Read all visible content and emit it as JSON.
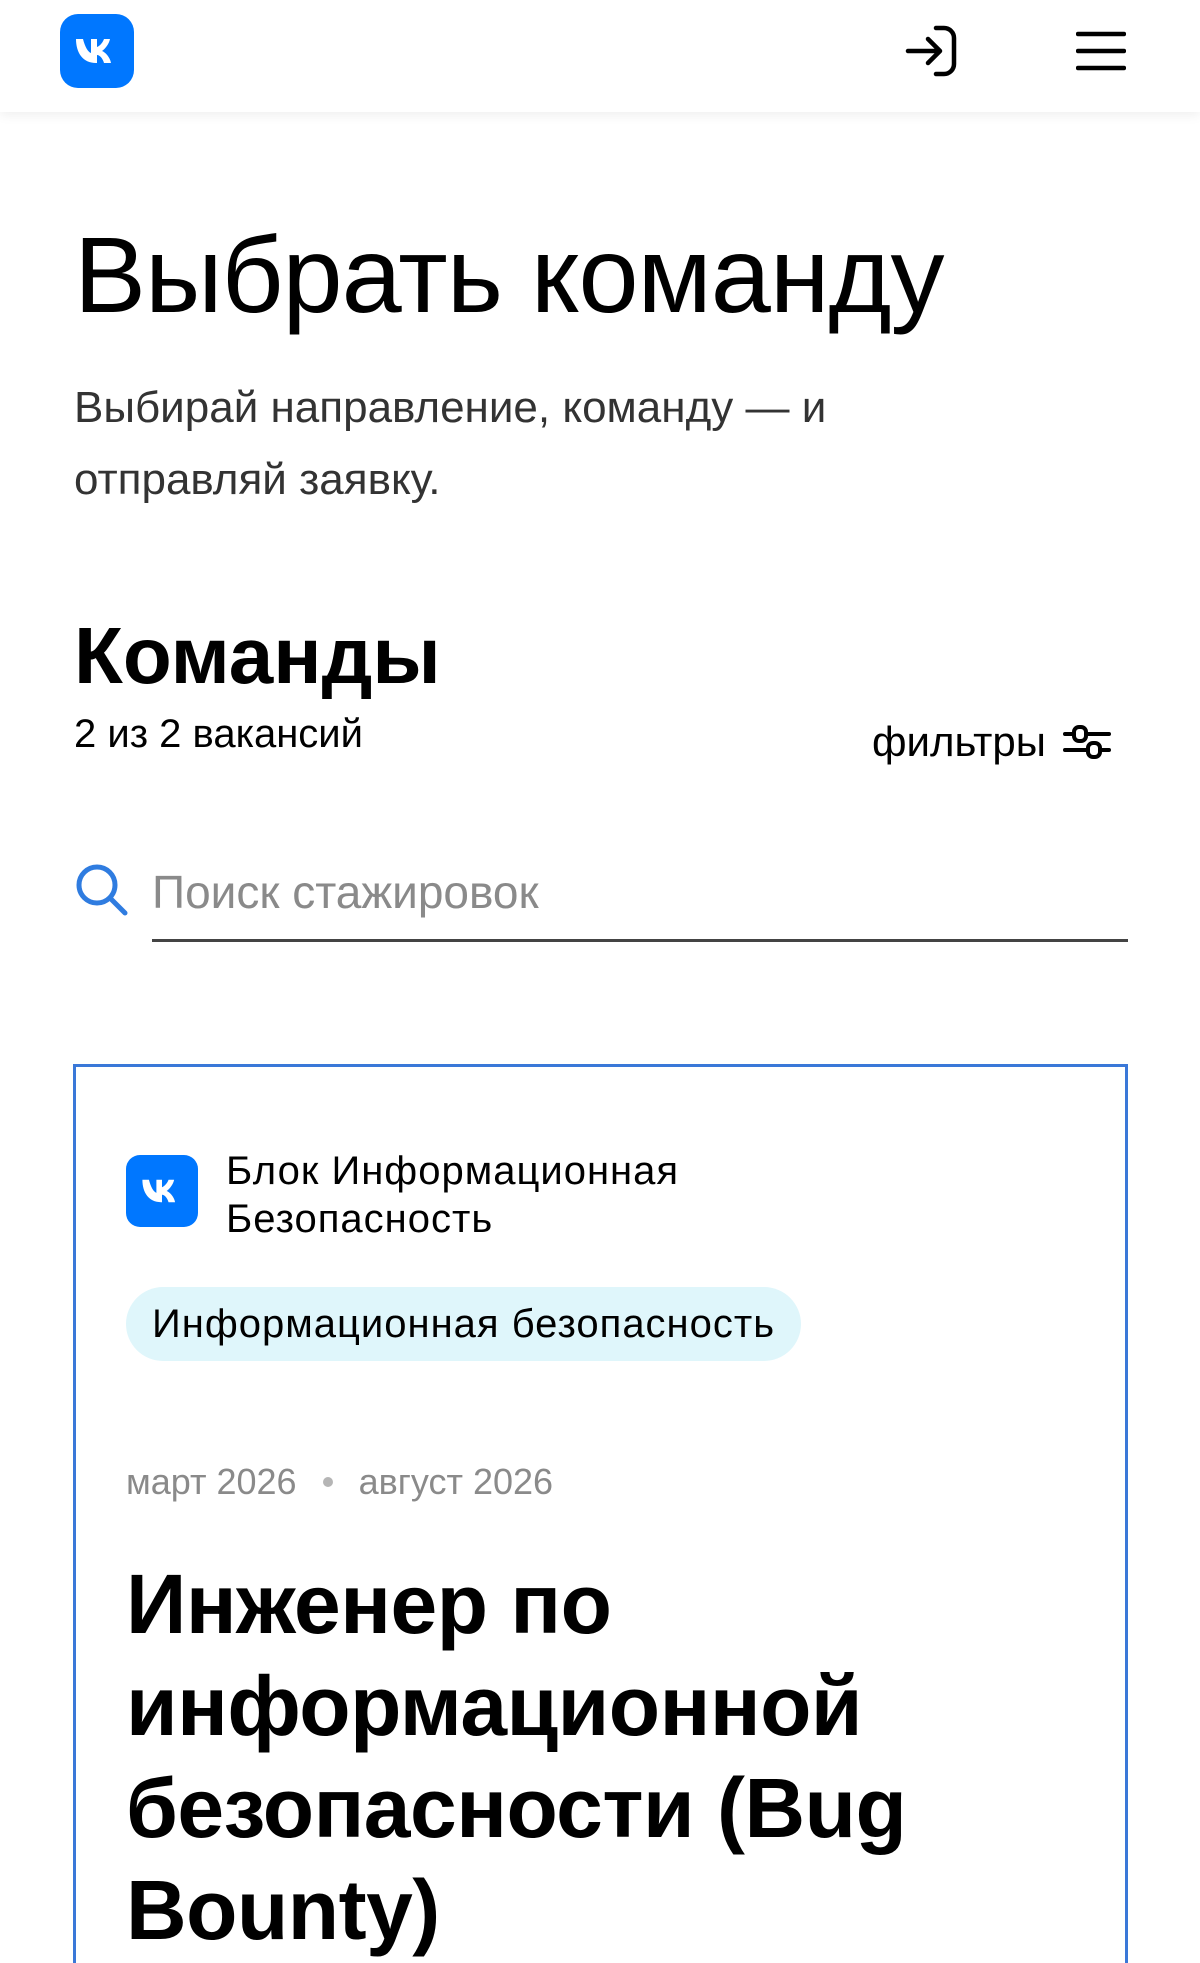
{
  "header": {
    "logo": "vk-logo",
    "login_icon": "login-icon",
    "menu_icon": "hamburger-menu-icon",
    "brand_color": "#0077ff"
  },
  "page": {
    "title": "Выбрать команду",
    "subtitle": "Выбирай направление, команду — и отправляй заявку."
  },
  "teams": {
    "title": "Команды",
    "count": "2 из 2 вакансий",
    "filters_label": "фильтры",
    "filters_icon": "sliders-icon"
  },
  "search": {
    "placeholder": "Поиск стажировок",
    "value": "",
    "icon": "search-icon"
  },
  "vacancies": [
    {
      "company": "Блок Информационная Безопасность",
      "tag": "Информационная безопасность",
      "date_start": "март 2026",
      "date_end": "август 2026",
      "title": "Инженер по информационной безопасности (Bug Bounty)",
      "border_color": "#3a78d8",
      "tag_color": "#dff6fb"
    }
  ]
}
